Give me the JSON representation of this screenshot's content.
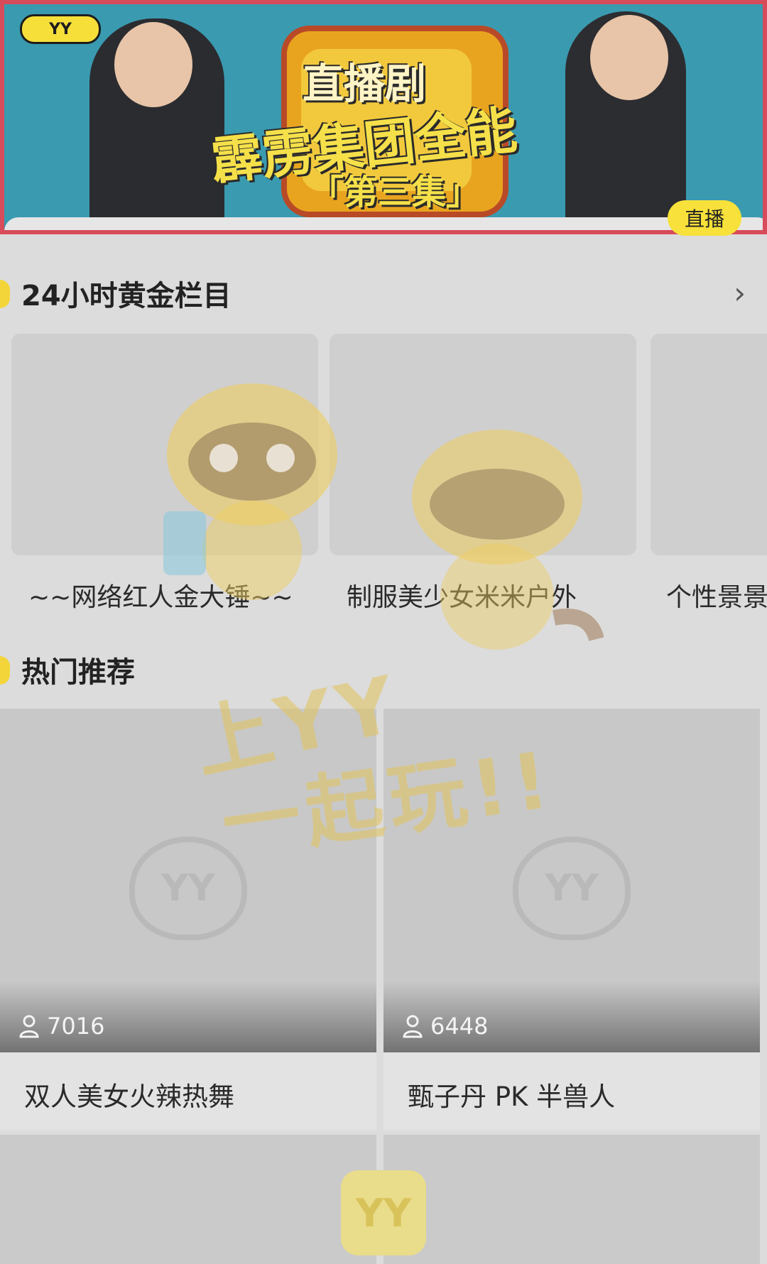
{
  "banner": {
    "logo_text": "YY",
    "title_line1": "直播剧",
    "title_line2": "霹雳集团全能",
    "title_line3": "「第三集」",
    "live_tag": "直播"
  },
  "golden_section": {
    "title": "24小时黄金栏目",
    "items": [
      {
        "label": "~~网络红人金大锤~~"
      },
      {
        "label": "制服美少女米米户外"
      },
      {
        "label": "个性景景"
      }
    ]
  },
  "hot_section": {
    "title": "热门推荐",
    "items": [
      {
        "viewers": "7016",
        "label": "双人美女火辣热舞"
      },
      {
        "viewers": "6448",
        "label": "甄子丹 PK 半兽人"
      }
    ]
  },
  "overlay": {
    "watermark_line1": "上YY",
    "watermark_line2": "一起玩!!",
    "app_icon_text": "YY"
  },
  "colors": {
    "accent_yellow": "#f3d53a",
    "banner_teal": "#3a9ab0",
    "banner_border": "#d84b5a"
  }
}
